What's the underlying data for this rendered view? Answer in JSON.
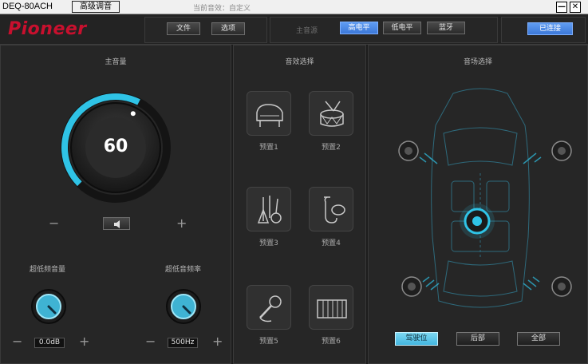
{
  "window": {
    "title": "DEQ-80ACH",
    "advanced_button": "高级调音",
    "current_sound_label": "当前音效：自定义",
    "minimize": "—",
    "close": "✕"
  },
  "topbar": {
    "logo": "Pioneer",
    "file_button": "文件",
    "options_button": "选项",
    "main_source_label": "主音源",
    "sources": [
      "高电平",
      "低电平",
      "蓝牙"
    ],
    "active_source": "高电平",
    "connection_status": "已连接"
  },
  "colors": {
    "accent_cyan": "#2fc3e6",
    "brand_red": "#c8102e",
    "active_blue": "#3c78d8"
  },
  "volume": {
    "title": "主音量",
    "value": "60",
    "level_fraction": 0.6,
    "minus": "−",
    "plus": "+",
    "mute_icon": "speaker-icon"
  },
  "subwoofer": {
    "volume_label": "超低频音量",
    "volume_value": "0.0dB",
    "freq_label": "超低音频率",
    "freq_value": "500Hz",
    "minus": "−",
    "plus": "+"
  },
  "effects": {
    "title": "音效选择",
    "presets": [
      {
        "label": "预置1",
        "icon": "piano-icon"
      },
      {
        "label": "预置2",
        "icon": "drum-icon"
      },
      {
        "label": "预置3",
        "icon": "guitar-icon"
      },
      {
        "label": "预置4",
        "icon": "saxophone-icon"
      },
      {
        "label": "预置5",
        "icon": "microphone-icon"
      },
      {
        "label": "预置6",
        "icon": "accordion-icon"
      }
    ]
  },
  "soundfield": {
    "title": "音场选择",
    "buttons": [
      "驾驶位",
      "后部",
      "全部"
    ],
    "active": "驾驶位"
  }
}
